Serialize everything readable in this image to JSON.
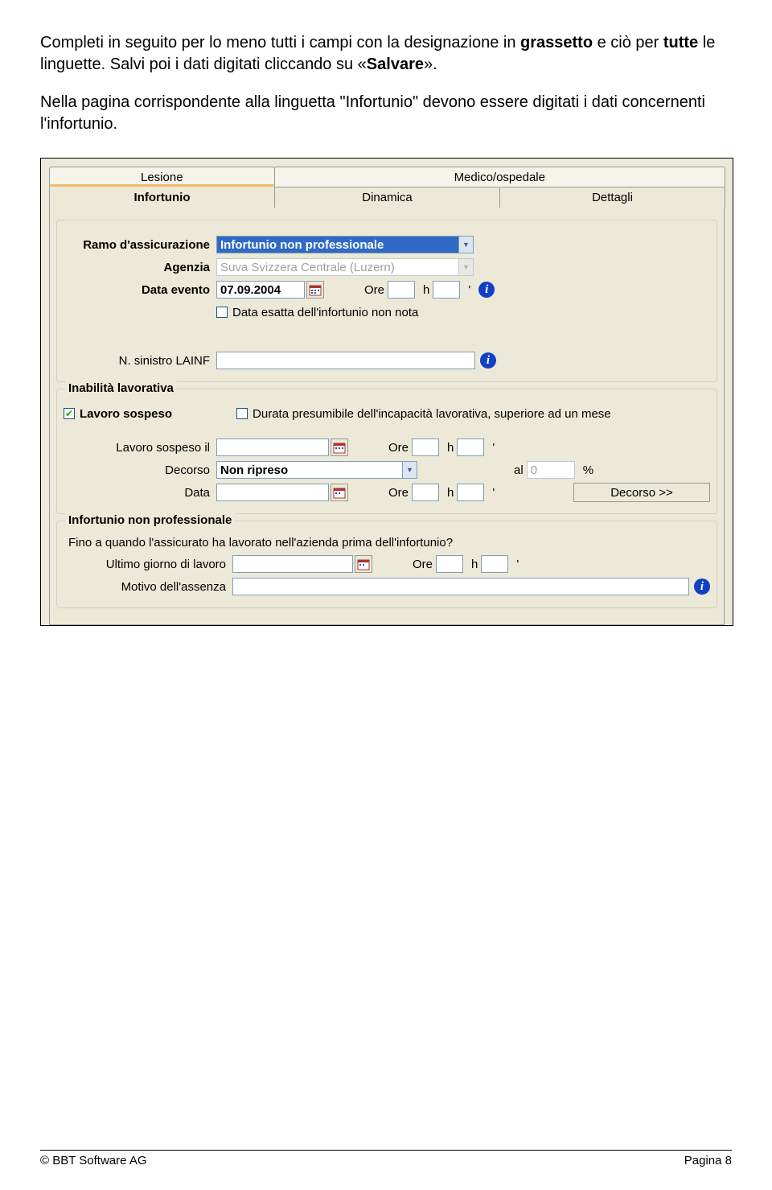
{
  "intro": {
    "t1a": "Completi in seguito per lo meno tutti i campi con la designazione in ",
    "t1b": "grassetto",
    "t1c": " e ciò per ",
    "t1d": "tutte",
    "t1e": " le linguette. Salvi poi i dati digitati cliccando su «",
    "t1f": "Salvare",
    "t1g": "».",
    "t2": "Nella pagina corrispondente alla linguetta \"Infortunio\" devono essere digitati i dati concernenti l'infortunio."
  },
  "tabs": {
    "back": [
      "Lesione",
      "Medico/ospedale"
    ],
    "front": [
      "Infortunio",
      "Dinamica",
      "Dettagli"
    ]
  },
  "top": {
    "ramo_label": "Ramo d'assicurazione",
    "ramo_value": "Infortunio non professionale",
    "agenzia_label": "Agenzia",
    "agenzia_value": "Suva Svizzera Centrale (Luzern)",
    "dataevento_label": "Data evento",
    "dataevento_value": "07.09.2004",
    "ore_label": "Ore",
    "h_label": "h",
    "tick": "'",
    "exactdate_cb": "Data esatta dell'infortunio non nota",
    "sinistro_label": "N. sinistro LAINF"
  },
  "inabilita": {
    "legend": "Inabilità lavorativa",
    "sospeso_cb": "Lavoro sospeso",
    "durata_cb": "Durata presumibile dell'incapacità lavorativa, superiore ad un mese",
    "sospeso_il": "Lavoro sospeso il",
    "decorso_label": "Decorso",
    "decorso_value": "Non ripreso",
    "al_label": "al",
    "zero": "0",
    "percent": "%",
    "data_label": "Data",
    "decorso_btn": "Decorso >>"
  },
  "nonprof": {
    "legend": "Infortunio non professionale",
    "question": "Fino a quando l'assicurato ha lavorato nell'azienda prima dell'infortunio?",
    "ultimo_label": "Ultimo giorno di lavoro",
    "motivo_label": "Motivo dell'assenza"
  },
  "footer": {
    "left": "© BBT Software AG",
    "right": "Pagina 8"
  },
  "shared": {
    "ore": "Ore",
    "h": "h",
    "tick": "'"
  }
}
